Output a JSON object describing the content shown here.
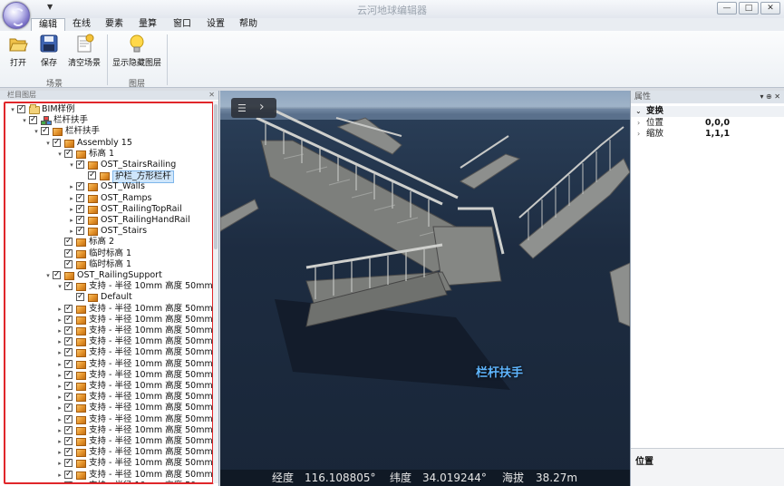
{
  "window": {
    "title": "云河地球编辑器",
    "controls": {
      "minimize": "—",
      "maximize": "□",
      "close": "✕"
    }
  },
  "ribbon": {
    "tabs": [
      "编辑",
      "在线",
      "要素",
      "量算",
      "窗口",
      "设置",
      "帮助"
    ],
    "active_tab": "编辑",
    "groups": [
      {
        "label": "场景",
        "buttons": [
          {
            "label": "打开",
            "icon": "folder-open-icon"
          },
          {
            "label": "保存",
            "icon": "save-disk-icon"
          },
          {
            "label": "清空场景",
            "icon": "clear-scene-icon"
          }
        ]
      },
      {
        "label": "图层",
        "buttons": [
          {
            "label": "显示隐藏图层",
            "icon": "lightbulb-icon"
          }
        ]
      }
    ]
  },
  "left_panel": {
    "title": "栏目图层",
    "tree": [
      {
        "level": 0,
        "exp": "▾",
        "icon": "folder",
        "label": "BIM样例"
      },
      {
        "level": 1,
        "exp": "▾",
        "icon": "multi",
        "label": "栏杆扶手"
      },
      {
        "level": 2,
        "exp": "▾",
        "icon": "box",
        "label": "栏杆扶手"
      },
      {
        "level": 3,
        "exp": "▾",
        "icon": "box",
        "label": "Assembly 15"
      },
      {
        "level": 4,
        "exp": "▾",
        "icon": "box",
        "label": "标高 1"
      },
      {
        "level": 5,
        "exp": "▾",
        "icon": "box",
        "label": "OST_StairsRailing"
      },
      {
        "level": 6,
        "exp": "",
        "icon": "box",
        "label": "护栏_方形栏杆",
        "selected": true
      },
      {
        "level": 5,
        "exp": "▸",
        "icon": "box",
        "label": "OST_Walls"
      },
      {
        "level": 5,
        "exp": "▸",
        "icon": "box",
        "label": "OST_Ramps"
      },
      {
        "level": 5,
        "exp": "▸",
        "icon": "box",
        "label": "OST_RailingTopRail"
      },
      {
        "level": 5,
        "exp": "▸",
        "icon": "box",
        "label": "OST_RailingHandRail"
      },
      {
        "level": 5,
        "exp": "▸",
        "icon": "box",
        "label": "OST_Stairs"
      },
      {
        "level": 4,
        "exp": "",
        "icon": "box",
        "label": "标高 2"
      },
      {
        "level": 4,
        "exp": "",
        "icon": "box",
        "label": "临时标高 1"
      },
      {
        "level": 4,
        "exp": "",
        "icon": "box",
        "label": "临时标高 1"
      },
      {
        "level": 3,
        "exp": "▾",
        "icon": "box",
        "label": "OST_RailingSupport"
      },
      {
        "level": 4,
        "exp": "▾",
        "icon": "box",
        "label": "支持 - 半径 10mm 高度 50mm"
      },
      {
        "level": 5,
        "exp": "",
        "icon": "box",
        "label": "Default"
      },
      {
        "level": 4,
        "exp": "▸",
        "icon": "box",
        "label": "支持 - 半径 10mm 高度 50mm"
      },
      {
        "level": 4,
        "exp": "▸",
        "icon": "box",
        "label": "支持 - 半径 10mm 高度 50mm"
      },
      {
        "level": 4,
        "exp": "▸",
        "icon": "box",
        "label": "支持 - 半径 10mm 高度 50mm"
      },
      {
        "level": 4,
        "exp": "▸",
        "icon": "box",
        "label": "支持 - 半径 10mm 高度 50mm"
      },
      {
        "level": 4,
        "exp": "▸",
        "icon": "box",
        "label": "支持 - 半径 10mm 高度 50mm"
      },
      {
        "level": 4,
        "exp": "▸",
        "icon": "box",
        "label": "支持 - 半径 10mm 高度 50mm"
      },
      {
        "level": 4,
        "exp": "▸",
        "icon": "box",
        "label": "支持 - 半径 10mm 高度 50mm"
      },
      {
        "level": 4,
        "exp": "▸",
        "icon": "box",
        "label": "支持 - 半径 10mm 高度 50mm"
      },
      {
        "level": 4,
        "exp": "▸",
        "icon": "box",
        "label": "支持 - 半径 10mm 高度 50mm"
      },
      {
        "level": 4,
        "exp": "▸",
        "icon": "box",
        "label": "支持 - 半径 10mm 高度 50mm"
      },
      {
        "level": 4,
        "exp": "▸",
        "icon": "box",
        "label": "支持 - 半径 10mm 高度 50mm"
      },
      {
        "level": 4,
        "exp": "▸",
        "icon": "box",
        "label": "支持 - 半径 10mm 高度 50mm"
      },
      {
        "level": 4,
        "exp": "▸",
        "icon": "box",
        "label": "支持 - 半径 10mm 高度 50mm"
      },
      {
        "level": 4,
        "exp": "▸",
        "icon": "box",
        "label": "支持 - 半径 10mm 高度 50mm"
      },
      {
        "level": 4,
        "exp": "▸",
        "icon": "box",
        "label": "支持 - 半径 10mm 高度 50mm"
      },
      {
        "level": 4,
        "exp": "▸",
        "icon": "box",
        "label": "支持 - 半径 10mm 高度 50mm"
      },
      {
        "level": 4,
        "exp": "▸",
        "icon": "box",
        "label": "支持 - 半径 10mm 高度 50mm"
      }
    ]
  },
  "viewport": {
    "toolbar": {
      "menu_icon": "☰",
      "next_icon": "›"
    },
    "scene_label": "栏杆扶手",
    "status": {
      "lon_label": "经度",
      "lon_value": "116.108805°",
      "lat_label": "纬度",
      "lat_value": "34.019244°",
      "alt_label": "海拔",
      "alt_value": "38.27m"
    }
  },
  "right_panel": {
    "title": "属性",
    "header_controls": "▾ ⊕ ✕",
    "category": "变换",
    "props": [
      {
        "name": "位置",
        "value": "0,0,0"
      },
      {
        "name": "缩放",
        "value": "1,1,1"
      }
    ],
    "description_title": "位置"
  }
}
